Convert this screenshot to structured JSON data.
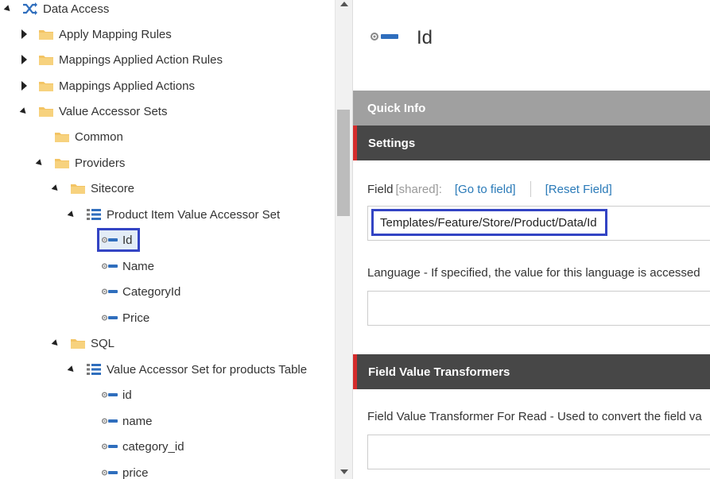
{
  "tree": {
    "items": [
      {
        "label": "Data Access",
        "icon": "shuffle-icon",
        "toggle": "expanded"
      },
      {
        "label": "Apply Mapping Rules",
        "icon": "folder-icon",
        "toggle": "collapsed"
      },
      {
        "label": "Mappings Applied Action Rules",
        "icon": "folder-icon",
        "toggle": "collapsed"
      },
      {
        "label": "Mappings Applied Actions",
        "icon": "folder-icon",
        "toggle": "collapsed"
      },
      {
        "label": "Value Accessor Sets",
        "icon": "folder-icon",
        "toggle": "expanded"
      },
      {
        "label": "Common",
        "icon": "folder-icon",
        "toggle": "none"
      },
      {
        "label": "Providers",
        "icon": "folder-icon",
        "toggle": "expanded"
      },
      {
        "label": "Sitecore",
        "icon": "folder-icon",
        "toggle": "expanded"
      },
      {
        "label": "Product Item Value Accessor Set",
        "icon": "list-icon",
        "toggle": "expanded"
      },
      {
        "label": "Id",
        "icon": "field-icon",
        "toggle": "none",
        "selected": true
      },
      {
        "label": "Name",
        "icon": "field-icon",
        "toggle": "none"
      },
      {
        "label": "CategoryId",
        "icon": "field-icon",
        "toggle": "none"
      },
      {
        "label": "Price",
        "icon": "field-icon",
        "toggle": "none"
      },
      {
        "label": "SQL",
        "icon": "folder-icon",
        "toggle": "expanded"
      },
      {
        "label": "Value Accessor Set for products Table",
        "icon": "list-icon",
        "toggle": "expanded"
      },
      {
        "label": "id",
        "icon": "field-icon",
        "toggle": "none"
      },
      {
        "label": "name",
        "icon": "field-icon",
        "toggle": "none"
      },
      {
        "label": "category_id",
        "icon": "field-icon",
        "toggle": "none"
      },
      {
        "label": "price",
        "icon": "field-icon",
        "toggle": "none"
      }
    ]
  },
  "editor": {
    "title": "Id",
    "title_icon": "field-icon",
    "quick_info": "Quick Info",
    "settings": "Settings",
    "field_label": "Field",
    "field_shared": "[shared]:",
    "go_to_field": "[Go to field]",
    "reset_field": "[Reset Field]",
    "field_value": "Templates/Feature/Store/Product/Data/Id",
    "language_label": "Language - If specified, the value for this language is accessed",
    "language_value": "",
    "fvt_section": "Field Value Transformers",
    "fvt_read_label": "Field Value Transformer For Read - Used to convert the field va",
    "fvt_read_value": ""
  },
  "colors": {
    "accent_red": "#d42b2b",
    "highlight_blue": "#3344c4",
    "link_blue": "#2a7ab8",
    "folder_yellow": "#f3c464",
    "section_dark": "#474747",
    "section_gray": "#a0a0a0"
  }
}
